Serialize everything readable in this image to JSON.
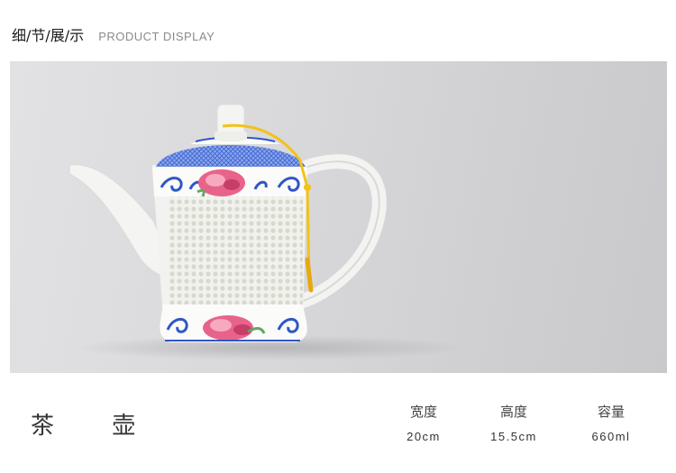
{
  "header": {
    "title_cn": "细/节/展/示",
    "title_en": "PRODUCT DISPLAY"
  },
  "product": {
    "name": "茶 壶",
    "image_alt": "teapot-photo"
  },
  "specs": [
    {
      "label": "宽度",
      "value": "20cm"
    },
    {
      "label": "高度",
      "value": "15.5cm"
    },
    {
      "label": "容量",
      "value": "660ml"
    }
  ],
  "colors": {
    "photo_background": "#d6d6d8",
    "porcelain": "#f3f4f2",
    "blue_pattern": "#2f56c8",
    "peony": "#e8638a",
    "tassel": "#f2c21a"
  }
}
